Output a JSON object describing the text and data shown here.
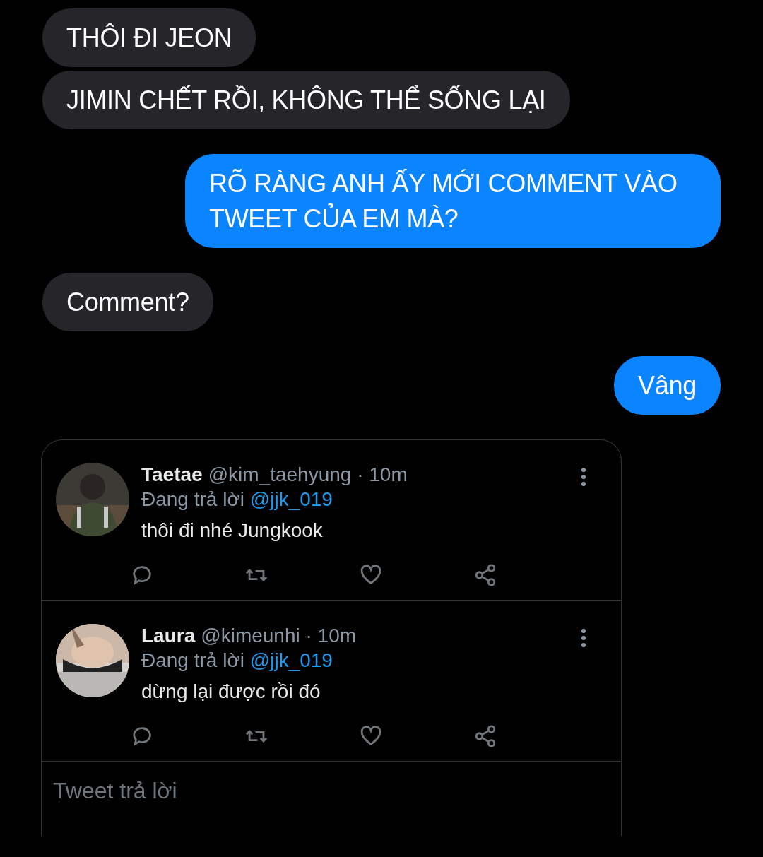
{
  "messages": [
    {
      "kind": "received",
      "text": "THÔI ĐI JEON"
    },
    {
      "kind": "received",
      "text": "JIMIN CHẾT RỒI, KHÔNG THỂ SỐNG LẠI"
    },
    {
      "kind": "sent",
      "text": "RÕ RÀNG ANH ẤY MỚI COMMENT VÀO TWEET CỦA EM MÀ?"
    },
    {
      "kind": "received",
      "text": "Comment?"
    },
    {
      "kind": "sent",
      "text": "Vâng"
    }
  ],
  "tweet_card": {
    "tweets": [
      {
        "name": "Taetae",
        "handle": "@kim_taehyung · 10m",
        "replying_label": "Đang trả lời",
        "reply_to": "@jjk_019",
        "text": "thôi đi nhé Jungkook"
      },
      {
        "name": "Laura",
        "handle": "@kimeunhi · 10m",
        "replying_label": "Đang trả lời",
        "reply_to": "@jjk_019",
        "text": "dừng lại được rồi đó"
      }
    ],
    "reply_field": {
      "placeholder": "Tweet trả lời"
    }
  }
}
